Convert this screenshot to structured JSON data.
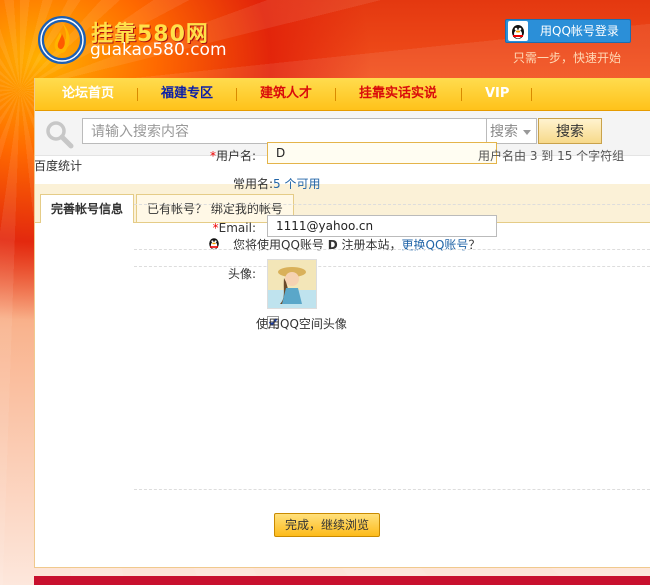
{
  "header": {
    "logo_cn": "挂靠580网",
    "logo_en": "guakao580.com",
    "qq_login_label": "用QQ帐号登录",
    "qq_login_sub": "只需一步，快速开始"
  },
  "nav": {
    "items": [
      {
        "label": "论坛首页",
        "color": "#ffffff"
      },
      {
        "label": "福建专区",
        "color": "#0b1ea8"
      },
      {
        "label": "建筑人才",
        "color": "#d90b0b"
      },
      {
        "label": "挂靠实话实说",
        "color": "#d90b0b"
      },
      {
        "label": "VIP",
        "color": "#ffffff"
      }
    ]
  },
  "search": {
    "placeholder": "请输入搜索内容",
    "select_value": "搜索",
    "button_label": "搜索"
  },
  "stats_label": "百度统计",
  "tabs": [
    {
      "label": "完善帐号信息",
      "active": true
    },
    {
      "label": "已有帐号？ 绑定我的帐号",
      "active": false
    }
  ],
  "form": {
    "notice_prefix": "您将使用QQ账号 ",
    "notice_account": "D",
    "notice_mid": " 注册本站，",
    "notice_link": "更换QQ账号",
    "notice_suffix": "？",
    "username_label": "用户名:",
    "username_value": "D",
    "username_hint": "用户名由 3 到 15 个字符组",
    "common_prefix": "常用名:",
    "common_link": "5 个可用",
    "email_label": "Email:",
    "email_value": "1111@yahoo.cn",
    "avatar_label": "头像:",
    "use_qq_avatar_label": "使用QQ空间头像",
    "use_qq_avatar_checked": true,
    "submit_label": "完成，继续浏览"
  },
  "colors": {
    "header_red": "#e43810",
    "nav_yellow": "#ffc21a",
    "link_blue": "#2366a8"
  }
}
